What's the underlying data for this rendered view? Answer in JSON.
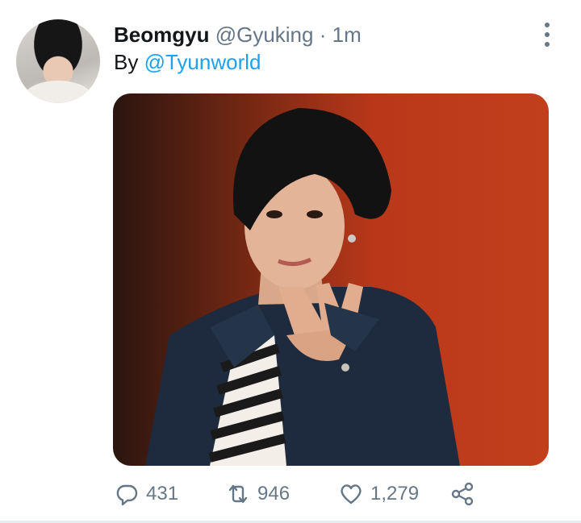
{
  "tweet": {
    "display_name": "Beomgyu",
    "handle": "@Gyuking",
    "separator": "·",
    "time": "1m",
    "by_prefix": "By",
    "mention": "@Tyunworld",
    "avatar_icon": "avatar-photo",
    "media_icon": "photo"
  },
  "actions": {
    "reply": {
      "icon": "reply-icon",
      "count": "431"
    },
    "retweet": {
      "icon": "retweet-icon",
      "count": "946"
    },
    "like": {
      "icon": "heart-icon",
      "count": "1,279"
    },
    "share": {
      "icon": "share-icon"
    }
  },
  "colors": {
    "link": "#1da1f2",
    "secondary_text": "#657786",
    "primary_text": "#14171a"
  }
}
